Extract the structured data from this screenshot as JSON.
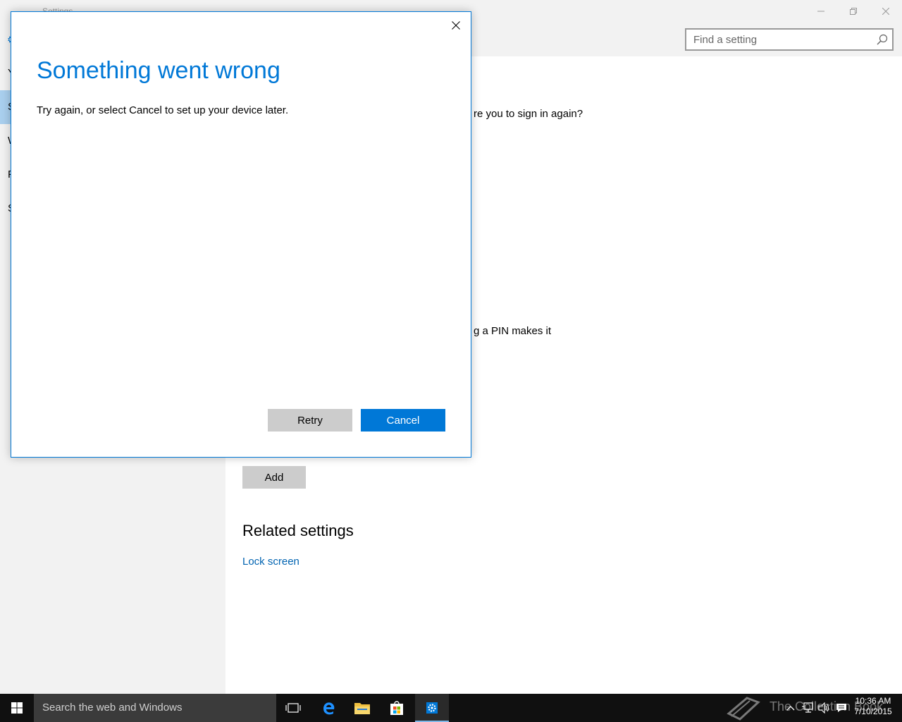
{
  "settings_window": {
    "title": "Settings",
    "search_placeholder": "Find a setting",
    "sidebar_initials": [
      "Y",
      "S",
      "W",
      "F",
      "S"
    ],
    "content_fragments": {
      "sign_in_question": "re you to sign in again?",
      "pin_text": "g a PIN makes it"
    },
    "add_label": "Add",
    "related_heading": "Related settings",
    "lock_screen_link": "Lock screen"
  },
  "dialog": {
    "title": "Something went wrong",
    "message": "Try again, or select Cancel to set up your device later.",
    "retry_label": "Retry",
    "cancel_label": "Cancel"
  },
  "taskbar": {
    "search_text": "Search the web and Windows",
    "watermark_text": "The Collection Book",
    "clock": {
      "time": "10:36 AM",
      "date": "7/10/2015"
    }
  },
  "colors": {
    "accent": "#0078d7",
    "sidebar_bg": "#f2f2f2",
    "selected_item": "#a9cfee",
    "taskbar_bg": "#101010"
  },
  "icons": [
    "back-arrow-icon",
    "minimize-icon",
    "maximize-icon",
    "close-icon",
    "search-icon",
    "windows-start-icon",
    "task-view-icon",
    "edge-icon",
    "file-explorer-icon",
    "store-icon",
    "gear-icon",
    "chevron-up-icon",
    "network-icon",
    "volume-icon",
    "action-center-icon"
  ]
}
